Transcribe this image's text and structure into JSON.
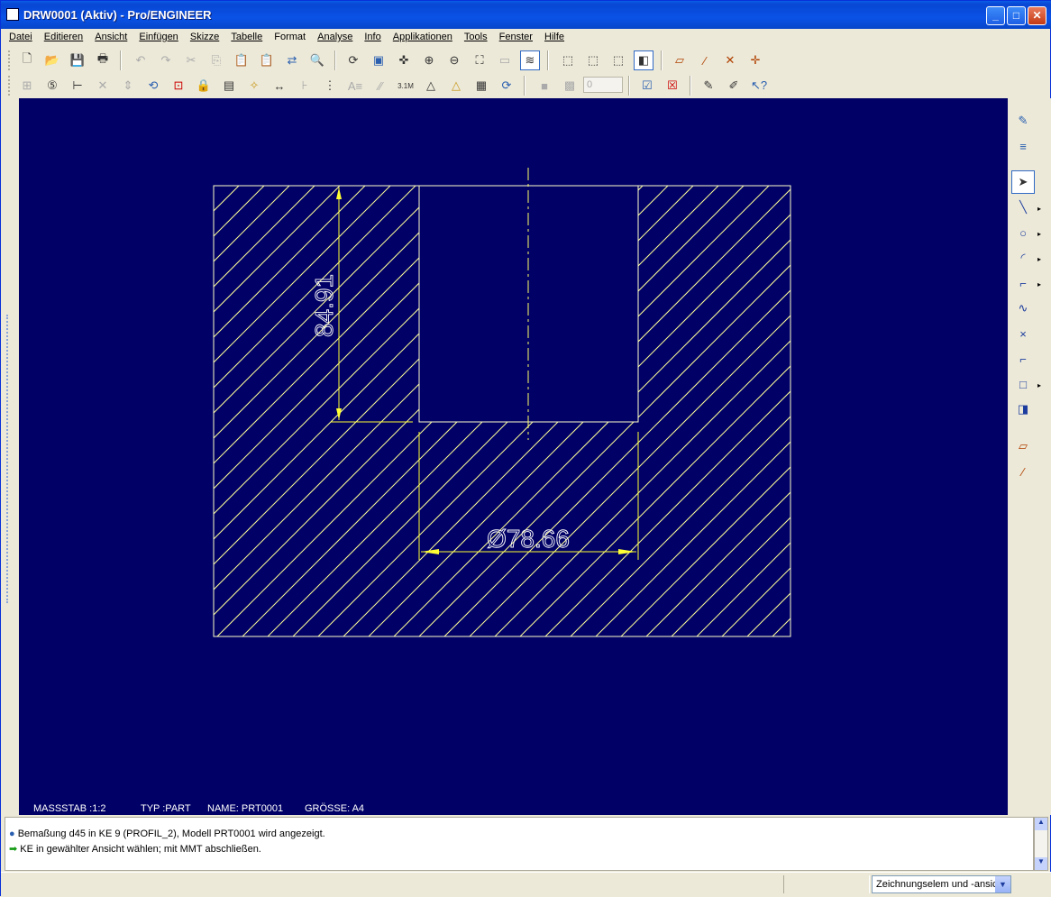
{
  "window": {
    "title": "DRW0001 (Aktiv) - Pro/ENGINEER",
    "buttons": {
      "minimize": "_",
      "maximize": "□",
      "close": "✕"
    }
  },
  "menu": [
    {
      "label": "Datei"
    },
    {
      "label": "Editieren"
    },
    {
      "label": "Ansicht"
    },
    {
      "label": "Einfügen"
    },
    {
      "label": "Skizze"
    },
    {
      "label": "Tabelle"
    },
    {
      "label": "Format"
    },
    {
      "label": "Analyse"
    },
    {
      "label": "Info"
    },
    {
      "label": "Applikationen"
    },
    {
      "label": "Tools"
    },
    {
      "label": "Fenster"
    },
    {
      "label": "Hilfe"
    }
  ],
  "toolbar": {
    "spin_value": "0"
  },
  "drawing": {
    "dim_vertical": "84.91",
    "dim_diameter": "Ø78.66",
    "colors": {
      "background": "#000066",
      "geometry": "#ffff99",
      "dimension": "#ffff00",
      "text": "#ffffff"
    },
    "sheet_info": {
      "scale": "MASSSTAB :1:2",
      "type": "TYP :PART",
      "name": "NAME: PRT0001",
      "size": "GRÖSSE: A4"
    }
  },
  "messages": [
    {
      "icon": "info-bullet-icon",
      "text": "Bemaßung d45 in KE 9 (PROFIL_2), Modell PRT0001 wird angezeigt."
    },
    {
      "icon": "prompt-arrow-icon",
      "text": "KE in gewählter Ansicht wählen; mit MMT abschließen."
    }
  ],
  "status": {
    "filter_value": "Zeichnungselem und -ansic"
  }
}
